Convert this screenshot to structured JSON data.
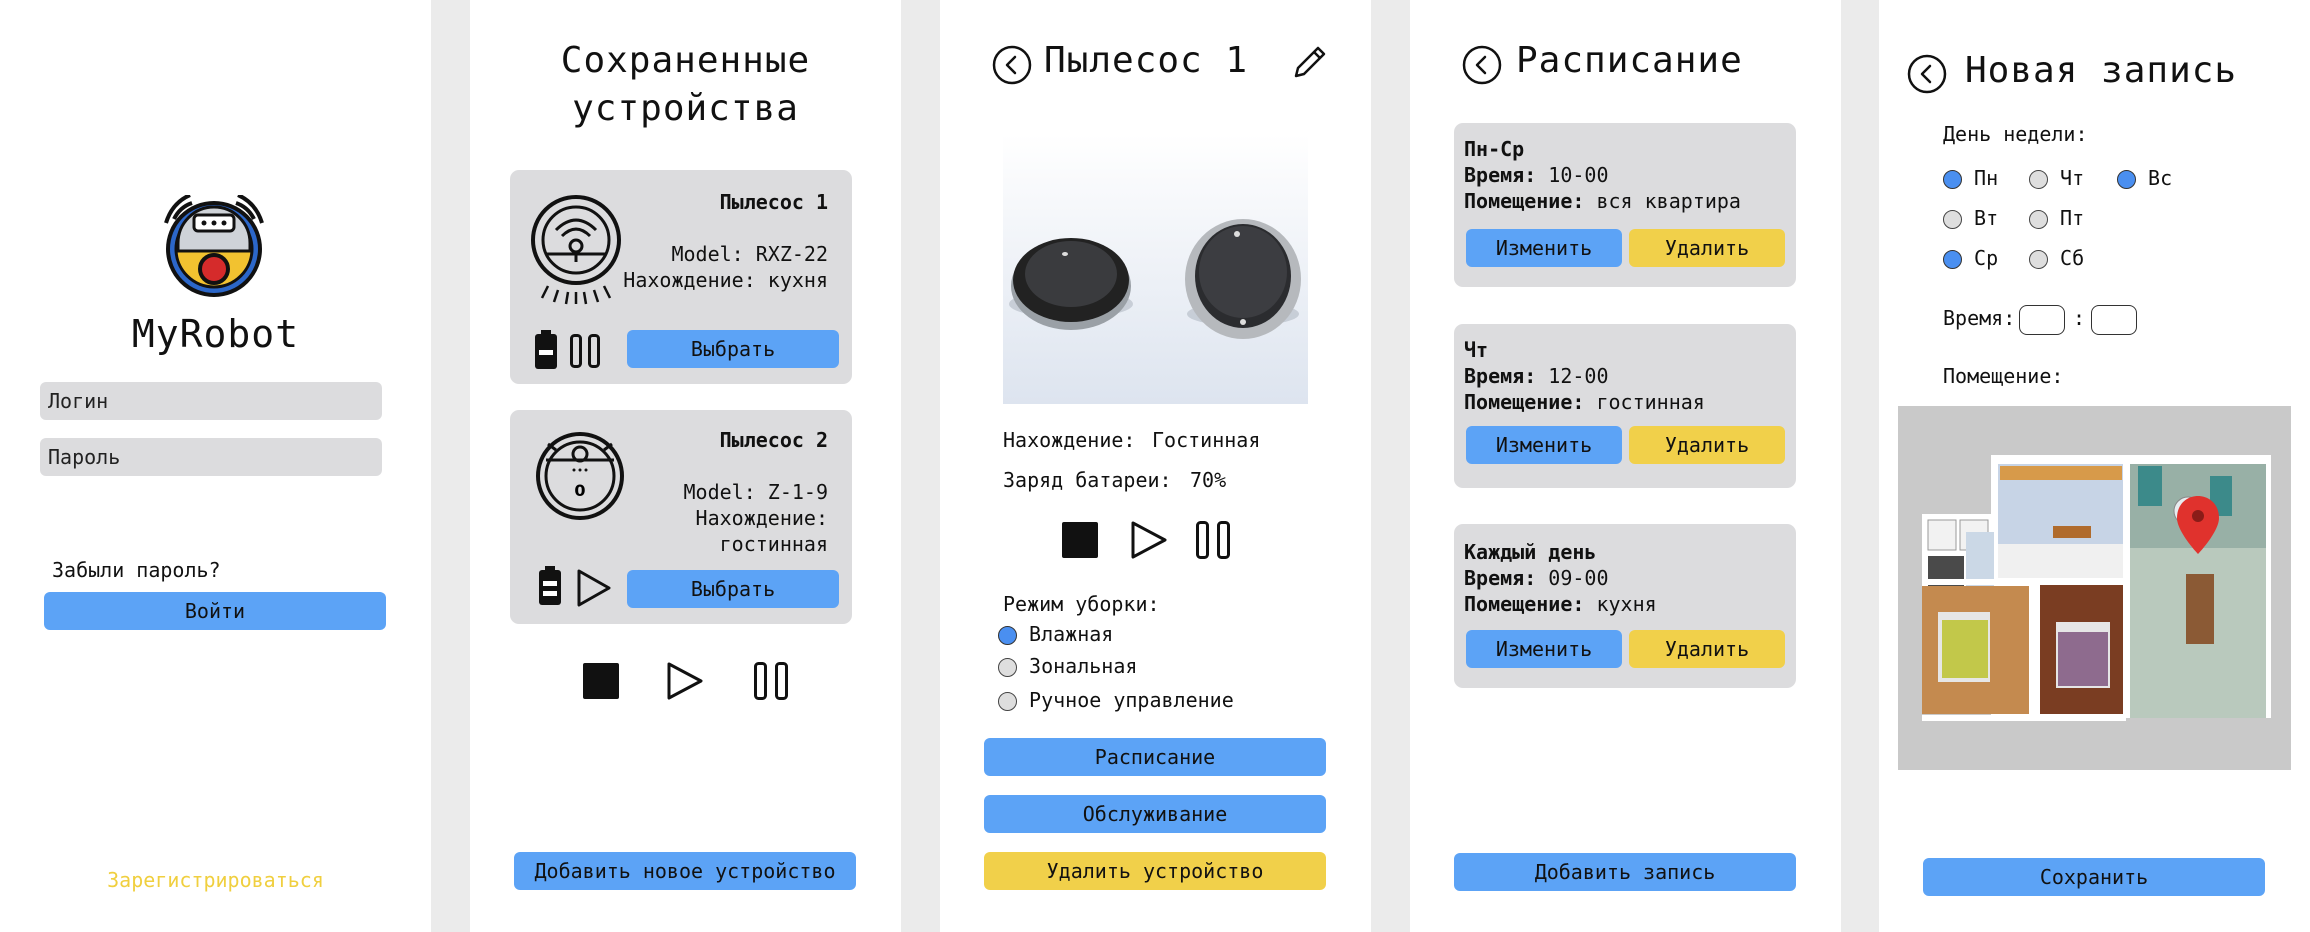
{
  "login": {
    "app_name": "MyRobot",
    "login_placeholder": "Логин",
    "password_placeholder": "Пароль",
    "forgot_password": "Забыли пароль?",
    "login_button": "Войти",
    "register_link": "Зарегистрироваться"
  },
  "saved_devices": {
    "title_line1": "Сохраненные",
    "title_line2": "устройства",
    "devices": [
      {
        "name": "Пылесос 1",
        "model": "Model: RXZ-22",
        "location_line1": "Нахождение: кухня",
        "location_line2": "",
        "select": "Выбрать"
      },
      {
        "name": "Пылесос 2",
        "model": "Model: Z-1-9",
        "location_line1": "Нахождение:",
        "location_line2": "гостинная",
        "select": "Выбрать"
      }
    ],
    "add_device": "Добавить новое устройство"
  },
  "device": {
    "title": "Пылесос 1",
    "location_label": "Нахождение:",
    "location_value": "Гостинная",
    "battery_label": "Заряд батареи:",
    "battery_value": "70%",
    "mode_label": "Режим уборки:",
    "modes": [
      {
        "label": "Влажная",
        "selected": true
      },
      {
        "label": "Зональная",
        "selected": false
      },
      {
        "label": "Ручное управление",
        "selected": false
      }
    ],
    "schedule_button": "Расписание",
    "service_button": "Обслуживание",
    "delete_button": "Удалить устройство"
  },
  "schedule": {
    "title": "Расписание",
    "entries": [
      {
        "days": "Пн-Ср",
        "time_label": "Время:",
        "time": "10-00",
        "room_label": "Помещение:",
        "room": "вся квартира",
        "edit": "Изменить",
        "delete": "Удалить"
      },
      {
        "days": "Чт",
        "time_label": "Время:",
        "time": "12-00",
        "room_label": "Помещение:",
        "room": "гостинная",
        "edit": "Изменить",
        "delete": "Удалить"
      },
      {
        "days": "Каждый день",
        "time_label": "Время:",
        "time": "09-00",
        "room_label": "Помещение:",
        "room": "кухня",
        "edit": "Изменить",
        "delete": "Удалить"
      }
    ],
    "add_entry": "Добавить запись"
  },
  "new_entry": {
    "title": "Новая запись",
    "weekday_label": "День недели:",
    "days": [
      {
        "label": "Пн",
        "checked": true
      },
      {
        "label": "Вт",
        "checked": false
      },
      {
        "label": "Ср",
        "checked": true
      },
      {
        "label": "Чт",
        "checked": false
      },
      {
        "label": "Пт",
        "checked": false
      },
      {
        "label": "Сб",
        "checked": false
      },
      {
        "label": "Вс",
        "checked": true
      }
    ],
    "time_label": "Время:",
    "time_separator": ":",
    "room_label": "Помещение:",
    "save_button": "Сохранить"
  },
  "colors": {
    "accent_blue": "#5ca3f6",
    "accent_yellow": "#f1d04a",
    "card_gray": "#dcdcde",
    "link_yellow": "#f0cf3f"
  }
}
